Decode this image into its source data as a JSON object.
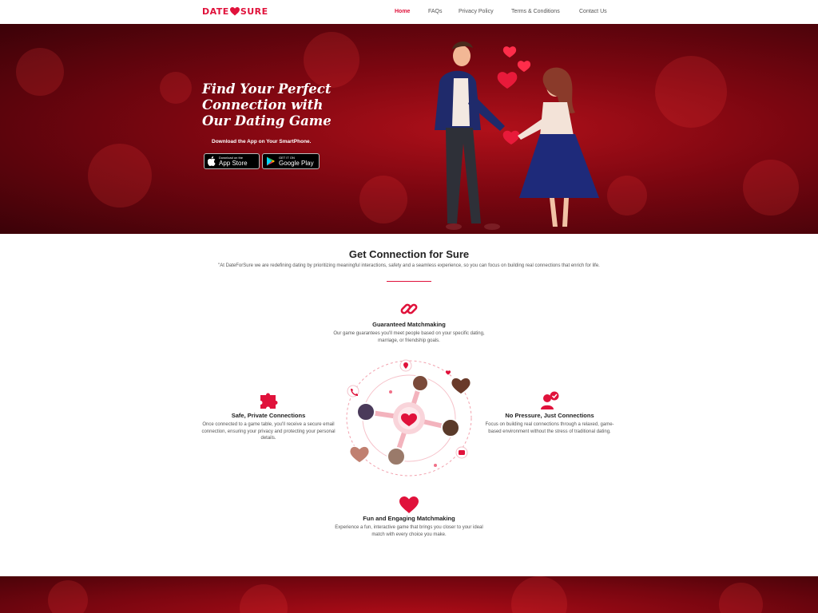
{
  "header": {
    "logo_left": "DATE",
    "logo_right": "SURE",
    "nav": [
      {
        "label": "Home",
        "active": true
      },
      {
        "label": "FAQs",
        "active": false
      },
      {
        "label": "Privacy Policy",
        "active": false
      },
      {
        "label": "Terms & Conditions",
        "active": false
      },
      {
        "label": "Contact Us",
        "active": false
      }
    ]
  },
  "hero": {
    "title_line1": "Find Your Perfect",
    "title_line2": "Connection with",
    "title_line3": "Our Dating Game",
    "subtitle": "Download the App on Your SmartPhone.",
    "appstore_small": "Download on the",
    "appstore_big": "App Store",
    "googleplay_small": "GET IT ON",
    "googleplay_big": "Google Play"
  },
  "section": {
    "title": "Get Connection for Sure",
    "description": "\"At DateForSure we are redefining dating by prioritizing meaningful interactions, safety and a seamless experience, so you can focus on building real connections that enrich for life.",
    "features": {
      "top": {
        "title": "Guaranteed Matchmaking",
        "text": "Our game guarantees you'll meet people based on your specific dating, marriage, or friendship goals."
      },
      "left": {
        "title": "Safe, Private Connections",
        "text": "Once connected to a game table, you'll receive a secure email connection, ensuring your privacy and protecting your personal details."
      },
      "right": {
        "title": "No Pressure, Just Connections",
        "text": "Focus on building real connections through a relaxed, game-based environment without the stress of traditional dating."
      },
      "bottom": {
        "title": "Fun and Engaging Matchmaking",
        "text": "Experience a fun, interactive game that brings you closer to your ideal match with every choice you make."
      }
    }
  },
  "colors": {
    "accent": "#e0123b",
    "hero_dark": "#3b0208",
    "hero_mid": "#7a0610"
  }
}
